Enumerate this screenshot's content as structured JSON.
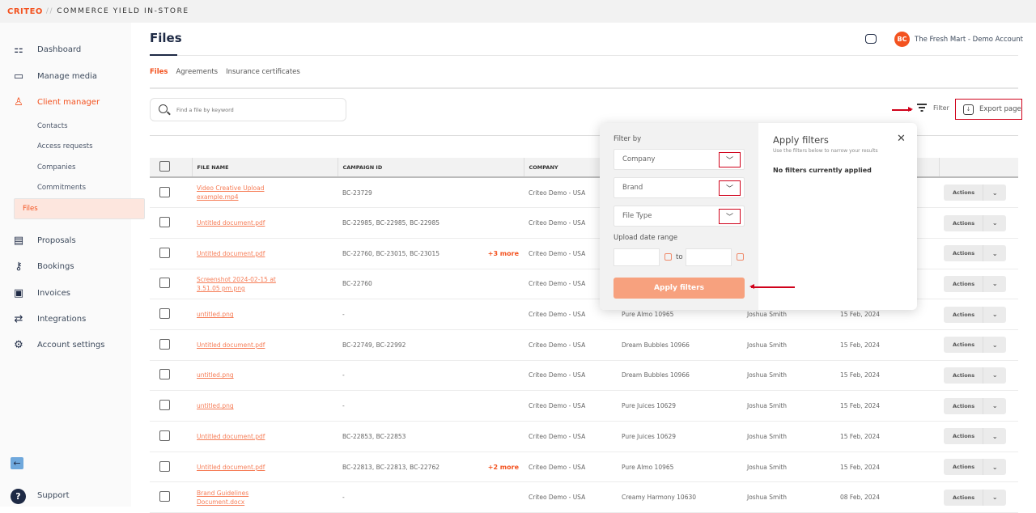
{
  "brand": {
    "logo": "CRITEO",
    "separator": "//",
    "product": "COMMERCE YIELD IN-STORE"
  },
  "sidebar": {
    "items": [
      {
        "label": "Dashboard",
        "icon": "grid-icon"
      },
      {
        "label": "Manage media",
        "icon": "monitor-icon"
      },
      {
        "label": "Client manager",
        "icon": "user-icon"
      },
      {
        "label": "Proposals",
        "icon": "clipboard-icon"
      },
      {
        "label": "Bookings",
        "icon": "key-icon"
      },
      {
        "label": "Invoices",
        "icon": "invoice-icon"
      },
      {
        "label": "Integrations",
        "icon": "arrows-icon"
      },
      {
        "label": "Account settings",
        "icon": "gear-icon"
      }
    ],
    "subitems": [
      "Contacts",
      "Access requests",
      "Companies",
      "Commitments",
      "Files"
    ],
    "support": "Support",
    "support_icon": "?"
  },
  "header": {
    "title": "Files",
    "account_initials": "BC",
    "account_name": "The Fresh Mart - Demo Account"
  },
  "tabs": [
    "Files",
    "Agreements",
    "Insurance certificates"
  ],
  "search": {
    "placeholder": "Find a file by keyword"
  },
  "toolbar": {
    "filter": "Filter",
    "export": "Export page"
  },
  "table": {
    "headers": [
      "FILE NAME",
      "CAMPAIGN ID",
      "COMPANY"
    ],
    "rows": [
      {
        "file": "Video Creative Upload example.mp4",
        "campaign": "BC-23729",
        "more": "",
        "company": "Criteo Demo - USA",
        "brand": "",
        "by": "",
        "date": "",
        "action": "Actions"
      },
      {
        "file": "Untitled document.pdf",
        "campaign": "BC-22985, BC-22985, BC-22985",
        "more": "",
        "company": "Criteo Demo - USA",
        "brand": "",
        "by": "",
        "date": "",
        "action": "Actions"
      },
      {
        "file": "Untitled document.pdf",
        "campaign": "BC-22760, BC-23015, BC-23015",
        "more": "+3 more",
        "company": "Criteo Demo - USA",
        "brand": "",
        "by": "",
        "date": "",
        "action": "Actions"
      },
      {
        "file": "Screenshot 2024-02-15 at 3.51.05 pm.png",
        "campaign": "BC-22760",
        "more": "",
        "company": "Criteo Demo - USA",
        "brand": "",
        "by": "",
        "date": "",
        "action": "Actions"
      },
      {
        "file": "untitled.png",
        "campaign": "-",
        "more": "",
        "company": "Criteo Demo - USA",
        "brand": "Pure Almo 10965",
        "by": "Joshua Smith",
        "date": "15 Feb, 2024",
        "action": "Actions"
      },
      {
        "file": "Untitled document.pdf",
        "campaign": "BC-22749, BC-22992",
        "more": "",
        "company": "Criteo Demo - USA",
        "brand": "Dream Bubbles 10966",
        "by": "Joshua Smith",
        "date": "15 Feb, 2024",
        "action": "Actions"
      },
      {
        "file": "untitled.png",
        "campaign": "-",
        "more": "",
        "company": "Criteo Demo - USA",
        "brand": "Dream Bubbles 10966",
        "by": "Joshua Smith",
        "date": "15 Feb, 2024",
        "action": "Actions"
      },
      {
        "file": "untitled.png",
        "campaign": "-",
        "more": "",
        "company": "Criteo Demo - USA",
        "brand": "Pure Juices 10629",
        "by": "Joshua Smith",
        "date": "15 Feb, 2024",
        "action": "Actions"
      },
      {
        "file": "Untitled document.pdf",
        "campaign": "BC-22853, BC-22853",
        "more": "",
        "company": "Criteo Demo - USA",
        "brand": "Pure Juices 10629",
        "by": "Joshua Smith",
        "date": "15 Feb, 2024",
        "action": "Actions"
      },
      {
        "file": "Untitled document.pdf",
        "campaign": "BC-22813, BC-22813, BC-22762",
        "more": "+2 more",
        "company": "Criteo Demo - USA",
        "brand": "Pure Almo 10965",
        "by": "Joshua Smith",
        "date": "15 Feb, 2024",
        "action": "Actions"
      },
      {
        "file": "Brand Guidelines Document.docx",
        "campaign": "-",
        "more": "",
        "company": "Criteo Demo - USA",
        "brand": "Creamy Harmony 10630",
        "by": "Joshua Smith",
        "date": "08 Feb, 2024",
        "action": "Actions"
      }
    ]
  },
  "filter_popover": {
    "filter_by": "Filter by",
    "selects": [
      "Company",
      "Brand",
      "File Type"
    ],
    "date_label": "Upload date range",
    "to": "to",
    "apply": "Apply filters",
    "title": "Apply filters",
    "subtitle": "Use the filters below to narrow your results",
    "empty": "No filters currently applied"
  },
  "colors": {
    "accent": "#f3521f",
    "annotation": "#d0021b",
    "apply": "#f7a17e"
  }
}
